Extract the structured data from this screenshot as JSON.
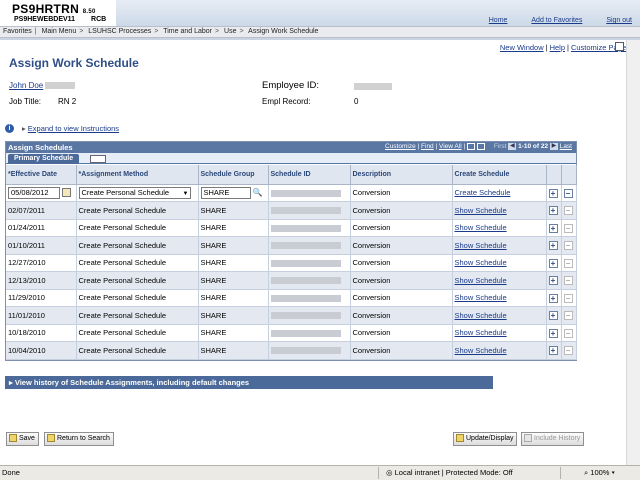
{
  "header": {
    "system_name": "PS9HRTRN",
    "version": "8.50",
    "server": "PS9HEWEBDEV11",
    "tag": "RCB",
    "links": [
      "Home",
      "Add to Favorites",
      "Sign out"
    ]
  },
  "breadcrumb": [
    "Favorites",
    "Main Menu",
    "LSUHSC Processes",
    "Time and Labor",
    "Use",
    "Assign Work Schedule"
  ],
  "page_links": {
    "new_window": "New Window",
    "help": "Help",
    "customize": "Customize Page"
  },
  "page_title": "Assign Work Schedule",
  "employee": {
    "name": "John Doe",
    "job_title_label": "Job Title:",
    "job_title": "RN 2",
    "id_label": "Employee ID:",
    "empl_record_label": "Empl Record:",
    "empl_record": "0"
  },
  "instructions_link": "Expand to view Instructions",
  "grid": {
    "title": "Assign Schedules",
    "tools": {
      "customize": "Customize",
      "find": "Find",
      "view_all": "View All",
      "first": "First",
      "range": "1-10 of 22",
      "last": "Last"
    },
    "tab_primary": "Primary Schedule",
    "columns": [
      "*Effective Date",
      "*Assignment Method",
      "Schedule Group",
      "Schedule ID",
      "Description",
      "Create Schedule"
    ],
    "first_row": {
      "date": "05/08/2012",
      "method": "Create Personal Schedule",
      "group": "SHARE",
      "description": "Conversion",
      "action": "Create Schedule"
    },
    "rows": [
      {
        "date": "02/07/2011",
        "method": "Create Personal Schedule",
        "group": "SHARE",
        "description": "Conversion",
        "action": "Show Schedule"
      },
      {
        "date": "01/24/2011",
        "method": "Create Personal Schedule",
        "group": "SHARE",
        "description": "Conversion",
        "action": "Show Schedule"
      },
      {
        "date": "01/10/2011",
        "method": "Create Personal Schedule",
        "group": "SHARE",
        "description": "Conversion",
        "action": "Show Schedule"
      },
      {
        "date": "12/27/2010",
        "method": "Create Personal Schedule",
        "group": "SHARE",
        "description": "Conversion",
        "action": "Show Schedule"
      },
      {
        "date": "12/13/2010",
        "method": "Create Personal Schedule",
        "group": "SHARE",
        "description": "Conversion",
        "action": "Show Schedule"
      },
      {
        "date": "11/29/2010",
        "method": "Create Personal Schedule",
        "group": "SHARE",
        "description": "Conversion",
        "action": "Show Schedule"
      },
      {
        "date": "11/01/2010",
        "method": "Create Personal Schedule",
        "group": "SHARE",
        "description": "Conversion",
        "action": "Show Schedule"
      },
      {
        "date": "10/18/2010",
        "method": "Create Personal Schedule",
        "group": "SHARE",
        "description": "Conversion",
        "action": "Show Schedule"
      },
      {
        "date": "10/04/2010",
        "method": "Create Personal Schedule",
        "group": "SHARE",
        "description": "Conversion",
        "action": "Show Schedule"
      }
    ]
  },
  "history_bar": "View history of Schedule Assignments, including default changes",
  "buttons": {
    "save": "Save",
    "return": "Return to Search",
    "update": "Update/Display",
    "include_history": "Include History"
  },
  "statusbar": {
    "left": "Done",
    "zone": "Local intranet | Protected Mode: Off",
    "zoom": "100%"
  },
  "colors": {
    "header_blue": "#5a77a4",
    "title_blue": "#2f4f86",
    "link_blue": "#1a3a8a",
    "row_alt": "#e4e9f1"
  }
}
